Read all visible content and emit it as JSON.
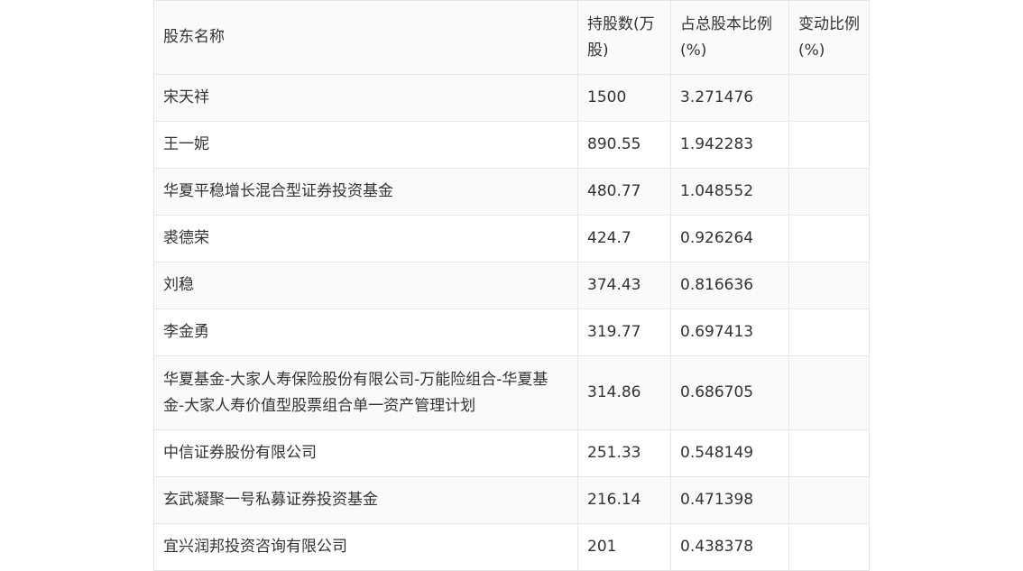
{
  "table": {
    "headers": [
      "股东名称",
      "持股数(万股)",
      "占总股本比例(%)",
      "变动比例(%)"
    ],
    "rows": [
      {
        "name": "宋天祥",
        "shares": "1500",
        "ratio": "3.271476",
        "change": ""
      },
      {
        "name": "王一妮",
        "shares": "890.55",
        "ratio": "1.942283",
        "change": ""
      },
      {
        "name": "华夏平稳增长混合型证券投资基金",
        "shares": "480.77",
        "ratio": "1.048552",
        "change": ""
      },
      {
        "name": "裘德荣",
        "shares": "424.7",
        "ratio": "0.926264",
        "change": ""
      },
      {
        "name": "刘稳",
        "shares": "374.43",
        "ratio": "0.816636",
        "change": ""
      },
      {
        "name": "李金勇",
        "shares": "319.77",
        "ratio": "0.697413",
        "change": ""
      },
      {
        "name": "华夏基金-大家人寿保险股份有限公司-万能险组合-华夏基金-大家人寿价值型股票组合单一资产管理计划",
        "shares": "314.86",
        "ratio": "0.686705",
        "change": ""
      },
      {
        "name": "中信证券股份有限公司",
        "shares": "251.33",
        "ratio": "0.548149",
        "change": ""
      },
      {
        "name": "玄武凝聚一号私募证券投资基金",
        "shares": "216.14",
        "ratio": "0.471398",
        "change": ""
      },
      {
        "name": "宜兴润邦投资咨询有限公司",
        "shares": "201",
        "ratio": "0.438378",
        "change": ""
      }
    ]
  }
}
